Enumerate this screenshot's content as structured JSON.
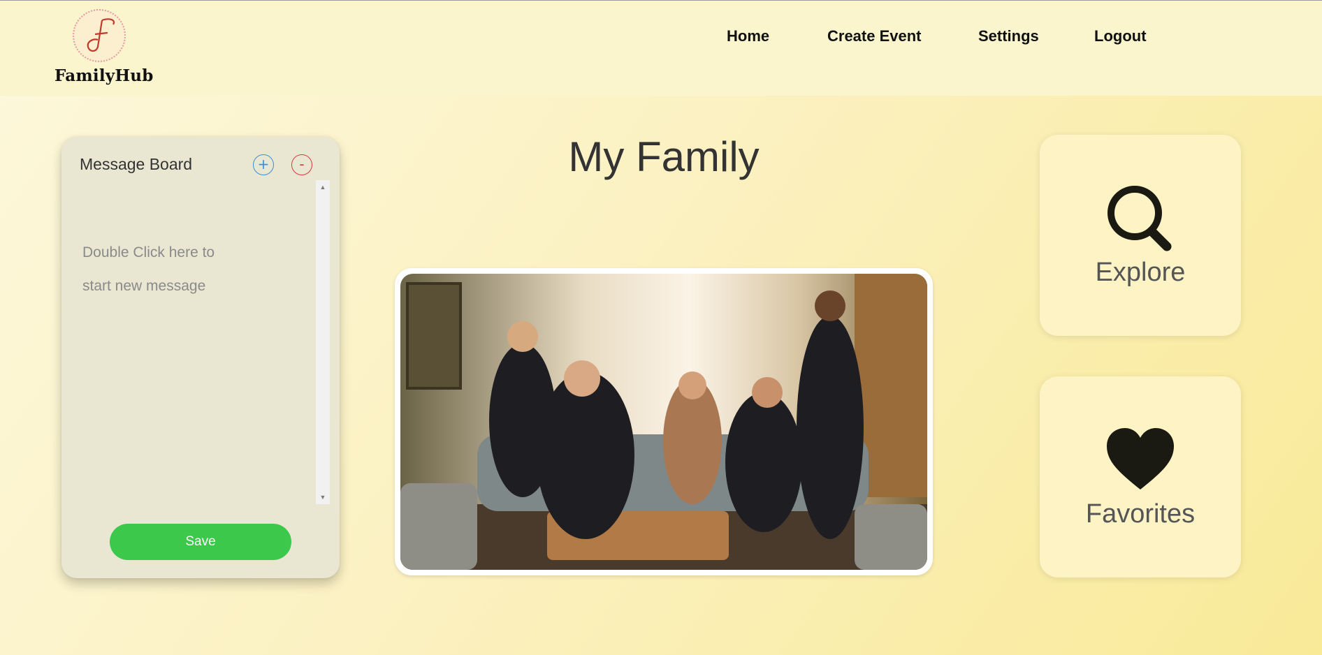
{
  "header": {
    "logo_text": "FamilyHub",
    "nav": [
      {
        "label": "Home"
      },
      {
        "label": "Create Event"
      },
      {
        "label": "Settings"
      },
      {
        "label": "Logout"
      }
    ]
  },
  "message_board": {
    "title": "Message Board",
    "add_label": "+",
    "remove_label": "-",
    "placeholder_line1": "Double Click here to",
    "placeholder_line2": "start new message",
    "save_label": "Save"
  },
  "main": {
    "title": "My Family"
  },
  "cards": {
    "explore_label": "Explore",
    "explore_icon": "search-icon",
    "favorites_label": "Favorites",
    "favorites_icon": "heart-icon"
  },
  "colors": {
    "save_button": "#3cc84a",
    "add_button": "#3b8fd4",
    "remove_button": "#d43b3b",
    "card_bg": "#fdf3c4",
    "panel_bg": "#e9e6d2"
  }
}
